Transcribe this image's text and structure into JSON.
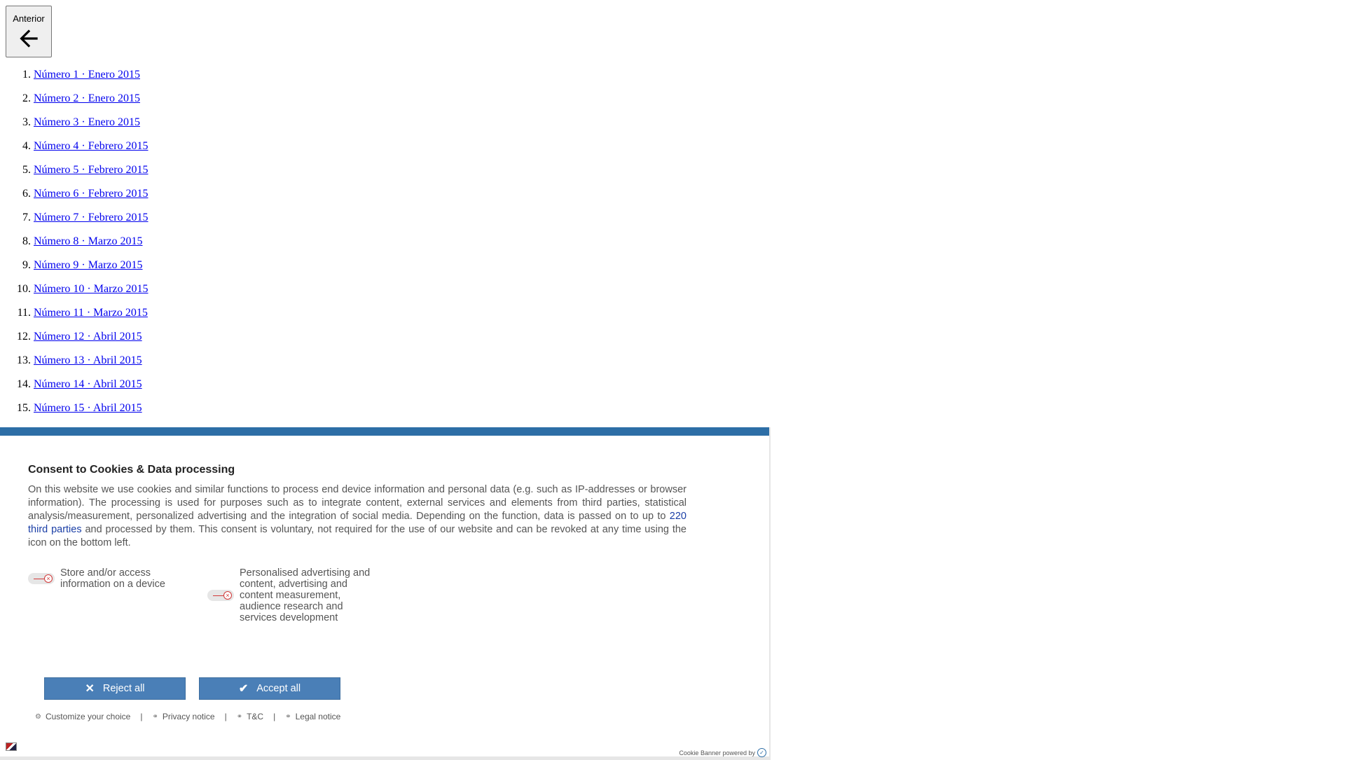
{
  "nav": {
    "prev_label": "Anterior",
    "prev_icon": "arrow-left-icon"
  },
  "issues": [
    "Número 1 · Enero 2015",
    "Número 2 · Enero 2015",
    "Número 3 · Enero 2015",
    "Número 4 · Febrero 2015",
    "Número 5 · Febrero 2015",
    "Número 6 · Febrero 2015",
    "Número 7 · Febrero 2015",
    "Número 8 · Marzo 2015",
    "Número 9 · Marzo 2015",
    "Número 10 · Marzo 2015",
    "Número 11 · Marzo 2015",
    "Número 12 · Abril 2015",
    "Número 13 · Abril 2015",
    "Número 14 · Abril 2015",
    "Número 15 · Abril 2015"
  ],
  "cookie_banner": {
    "accent_color": "#2d6ea6",
    "title": "Consent to Cookies & Data processing",
    "text_before_link": "On this website we use cookies and similar functions to process end device information and personal data (e.g. such as IP-addresses or browser information). The processing is used for purposes such as to integrate content, external services and elements from third parties, statistical analysis/measurement, personalized advertising and the integration of social media. Depending on the function, data is passed on to up to ",
    "third_parties_link": "220 third parties",
    "text_after_link": " and processed by them. This consent is voluntary, not required for the use of our website and can be revoked at any time using the icon on the bottom left.",
    "purposes": [
      {
        "label": "Store and/or access information on a device",
        "enabled": false
      },
      {
        "label": "Personalised advertising and content, advertising and content measurement, audience research and services development",
        "enabled": false
      }
    ],
    "reject_label": "Reject all",
    "accept_label": "Accept all",
    "links": {
      "customize": "Customize your choice",
      "privacy": "Privacy notice",
      "tc": "T&C",
      "legal": "Legal notice",
      "separator": "|"
    },
    "powered_by": "Cookie Banner powered by"
  }
}
